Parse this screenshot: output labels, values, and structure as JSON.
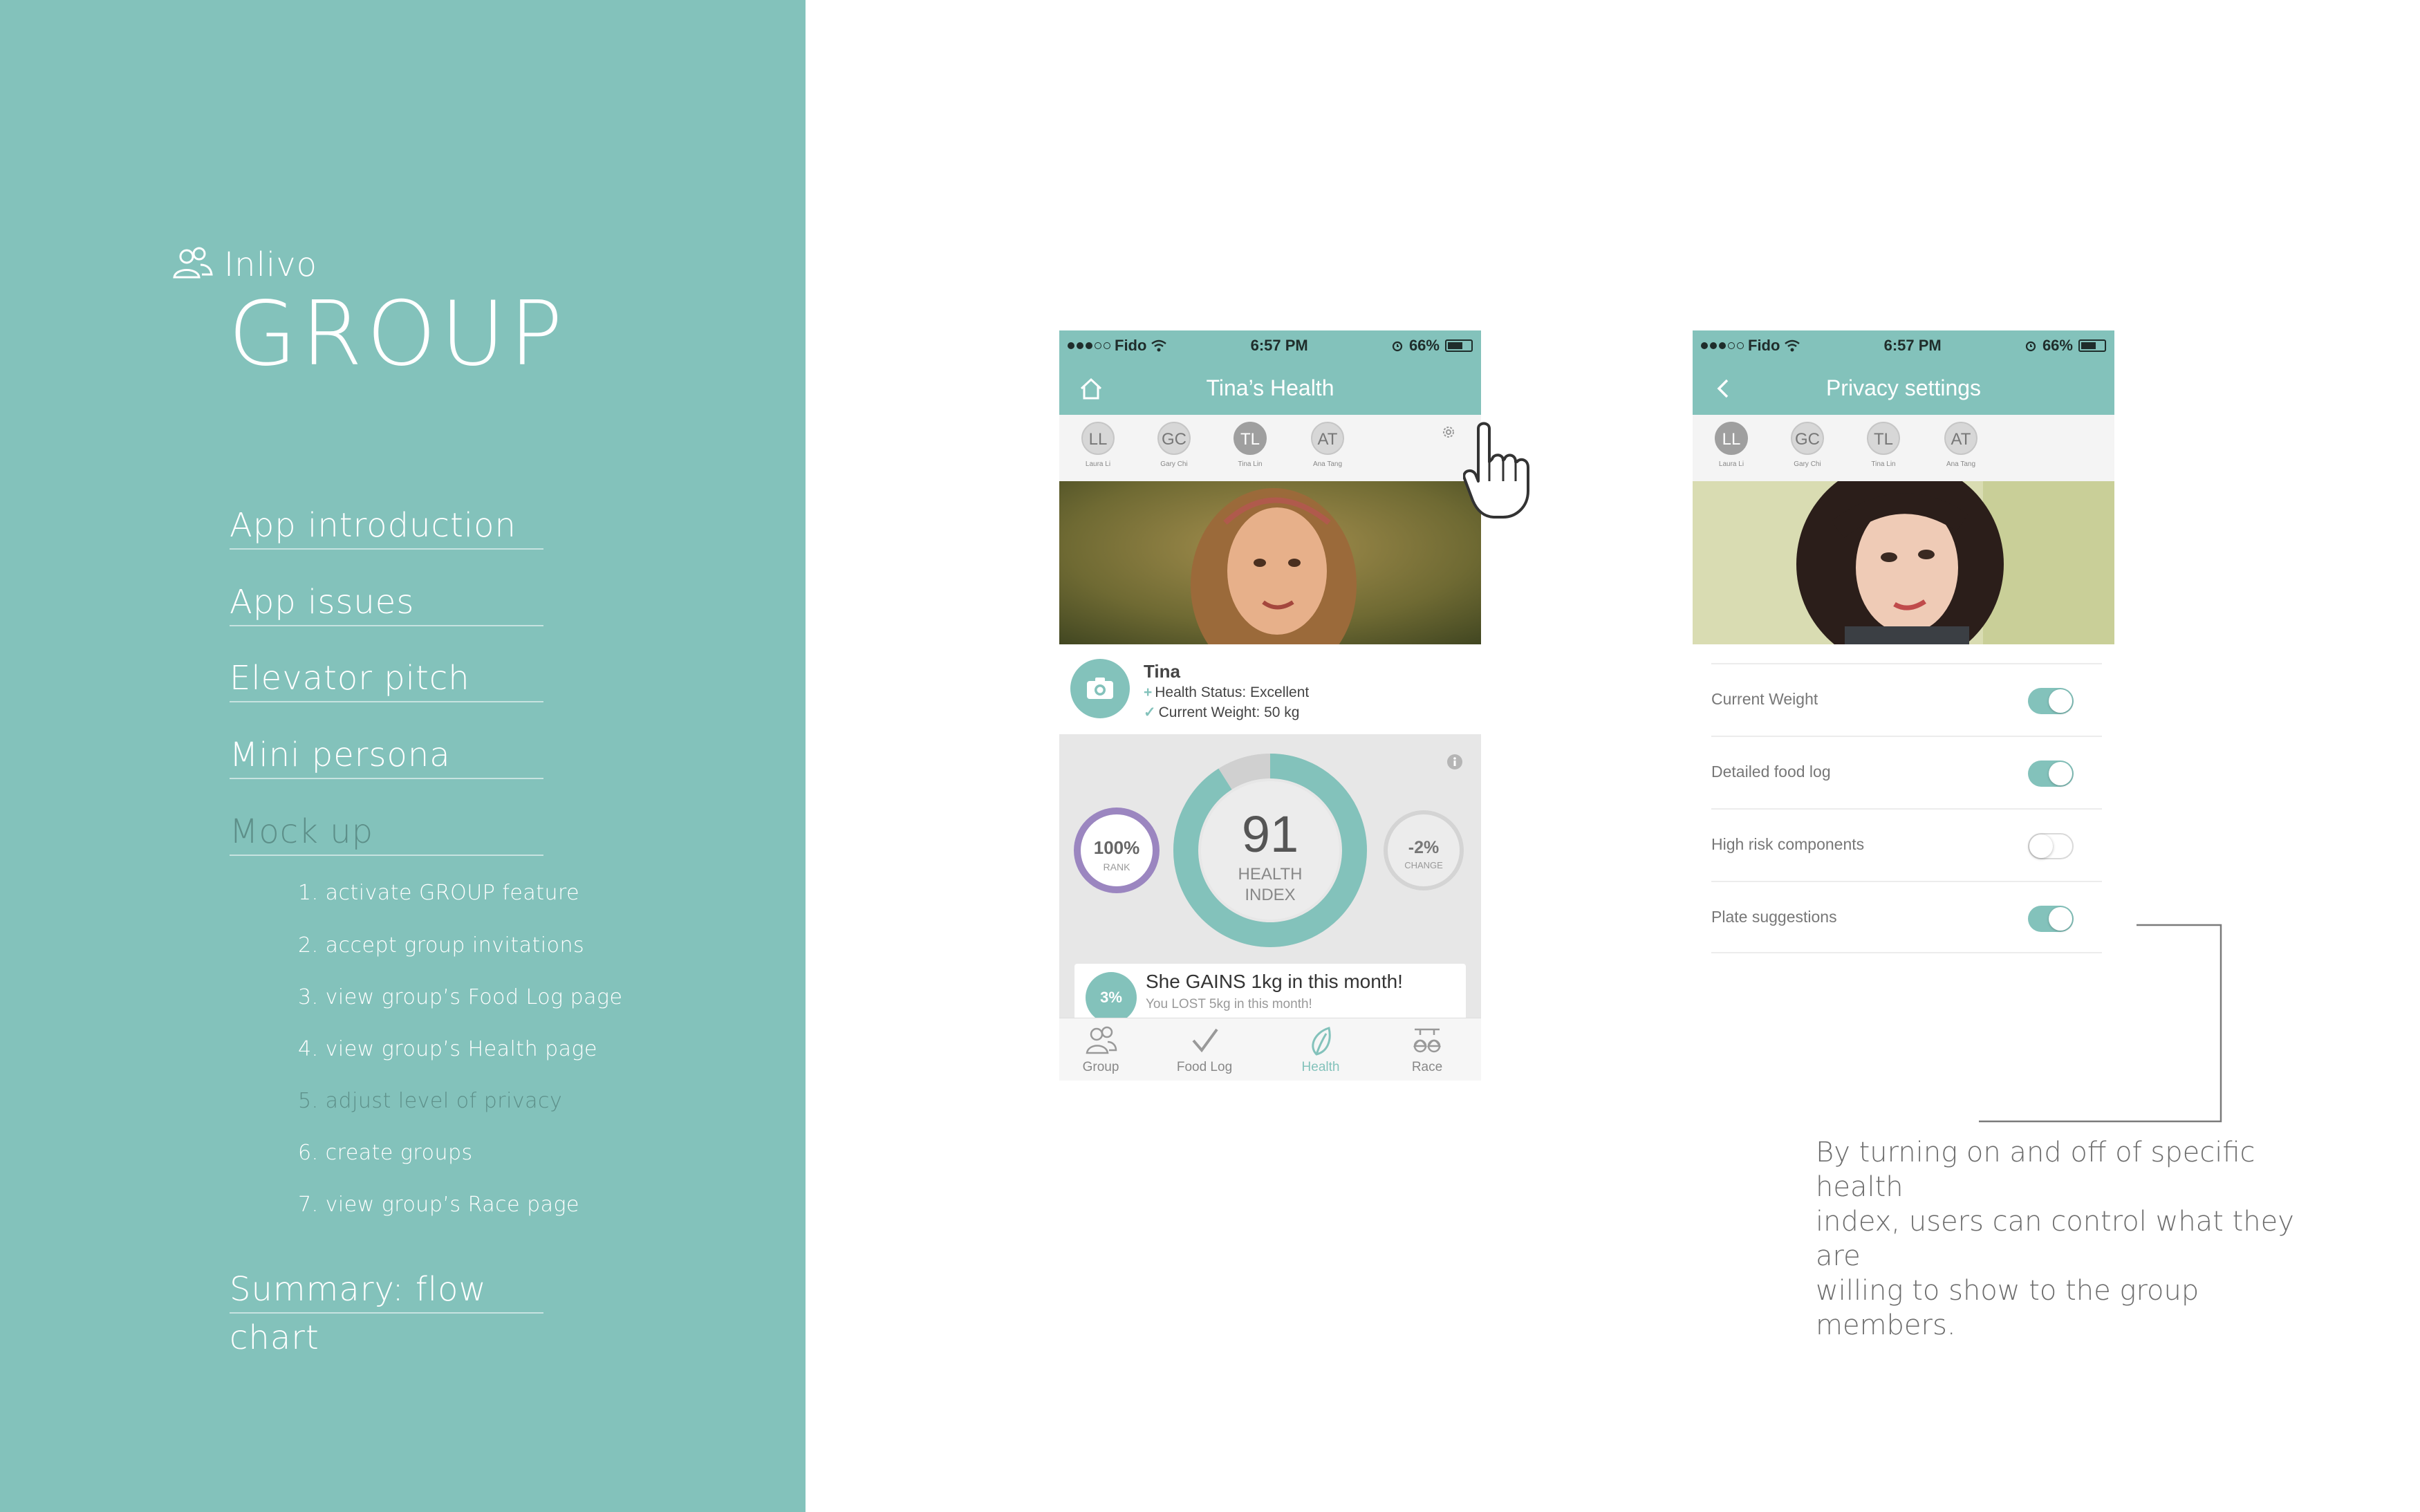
{
  "sidebar": {
    "brand": "Inlivo",
    "title": "GROUP",
    "nav": [
      "App introduction",
      "App issues",
      "Elevator pitch",
      "Mini persona",
      "Mock up",
      "Summary: flow chart"
    ],
    "mockup_items": [
      "1. activate GROUP feature",
      "2. accept group invitations",
      "3. view group’s Food Log page",
      "4. view group’s Health page",
      "5. adjust level of privacy",
      "6. create groups",
      "7. view group’s Race page"
    ]
  },
  "status_bar": {
    "carrier": "Fido",
    "time": "6:57 PM",
    "battery": "66%",
    "battery_level": 0.66
  },
  "health_screen": {
    "title": "Tina’s  Health",
    "members": [
      {
        "initials": "LL",
        "name": "Laura Li"
      },
      {
        "initials": "GC",
        "name": "Gary Chi"
      },
      {
        "initials": "TL",
        "name": "Tina Lin"
      },
      {
        "initials": "AT",
        "name": "Ana Tang"
      }
    ],
    "active_member": "TL",
    "profile": {
      "name": "Tina",
      "status": "Health Status: Excellent",
      "weight": "Current Weight: 50 kg"
    },
    "rank": {
      "value": "100%",
      "label": "RANK",
      "fraction": 1.0
    },
    "health_index": {
      "value": "91",
      "label_line1": "HEALTH",
      "label_line2": "INDEX",
      "fraction": 0.91
    },
    "change": {
      "value": "-2%",
      "label": "CHANGE"
    },
    "tip": {
      "badge": "3%",
      "title": "She GAINS 1kg in this month!",
      "subtitle": "You LOST 5kg in this month!"
    },
    "tabs": [
      "Group",
      "Food Log",
      "Health",
      "Race"
    ],
    "active_tab": "Health"
  },
  "privacy_screen": {
    "title": "Privacy settings",
    "members": [
      {
        "initials": "LL",
        "name": "Laura Li"
      },
      {
        "initials": "GC",
        "name": "Gary Chi"
      },
      {
        "initials": "TL",
        "name": "Tina Lin"
      },
      {
        "initials": "AT",
        "name": "Ana Tang"
      }
    ],
    "active_member": "LL",
    "toggles": [
      {
        "label": "Current Weight",
        "on": true
      },
      {
        "label": "Detailed food log",
        "on": true
      },
      {
        "label": "High risk components",
        "on": false
      },
      {
        "label": "Plate suggestions",
        "on": true
      }
    ]
  },
  "annotation": {
    "text_lines": [
      "By turning on and off of specific health",
      "index, users can control what they are",
      "willing to show to the group members."
    ]
  },
  "colors": {
    "accent": "#83c2bb",
    "rank": "#9b86c0",
    "dim_text": "#5d8f89"
  }
}
